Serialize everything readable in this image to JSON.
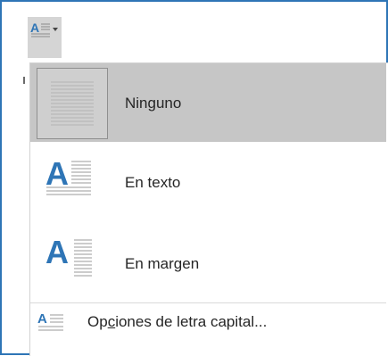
{
  "dropcap_button": {
    "icon": "drop-cap-icon",
    "arrow": "chevron-down-icon"
  },
  "menu": {
    "items": [
      {
        "label": "Ninguno",
        "icon": "no-drop-cap-icon",
        "selected": true
      },
      {
        "label": "En texto",
        "icon": "drop-cap-in-text-icon",
        "selected": false
      },
      {
        "label": "En margen",
        "icon": "drop-cap-in-margin-icon",
        "selected": false
      }
    ],
    "options": {
      "label_pre": "Op",
      "label_access": "c",
      "label_post": "iones de letra capital...",
      "icon": "drop-cap-options-icon"
    }
  },
  "colors": {
    "accent": "#2e75b6",
    "selected_bg": "#c6c6c6",
    "icon_blue": "#2e75b6"
  }
}
